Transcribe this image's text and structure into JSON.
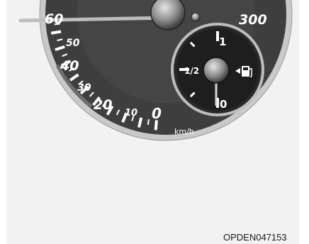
{
  "speedometer": {
    "unit": "km/h",
    "labels": [
      {
        "text": "60"
      },
      {
        "text": "50"
      },
      {
        "text": "40"
      },
      {
        "text": "30"
      },
      {
        "text": "20"
      },
      {
        "text": "10"
      },
      {
        "text": "0"
      },
      {
        "text": "300"
      }
    ]
  },
  "fuel_gauge": {
    "full_label": "1",
    "half_label": "1/2",
    "empty_label": "0",
    "icon": "fuel-pump-icon",
    "needle_level": 0
  },
  "figure_code": "OPDEN047153"
}
